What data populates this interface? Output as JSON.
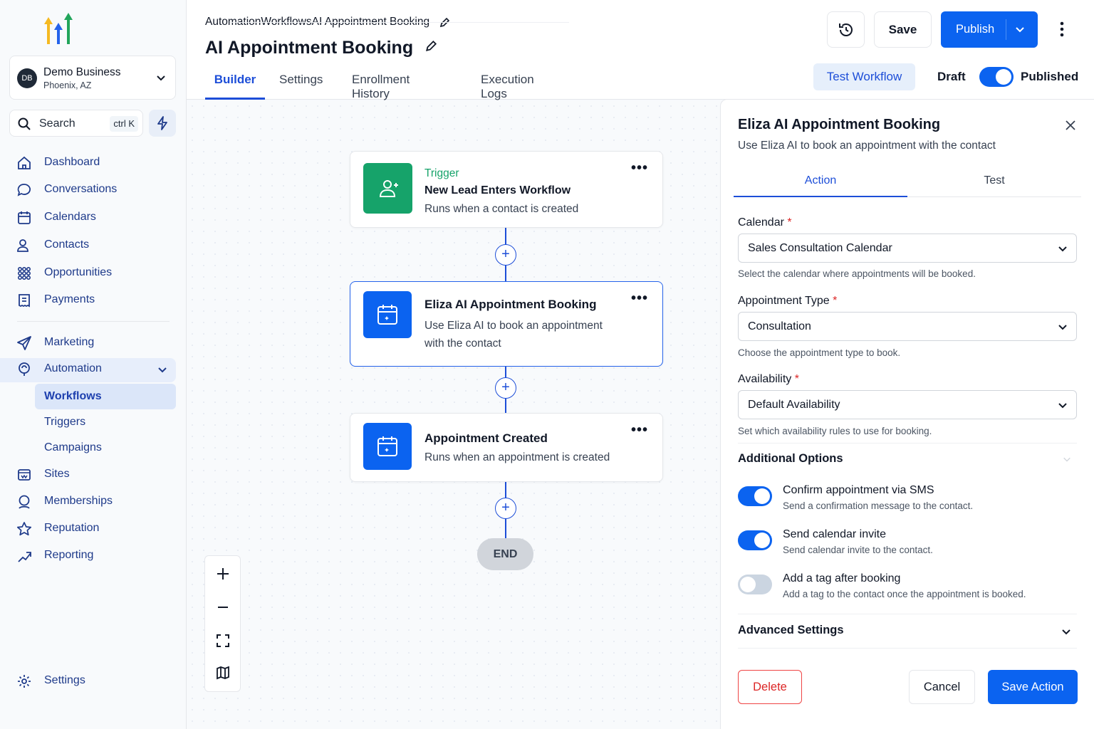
{
  "business": {
    "initials": "DB",
    "name": "Demo Business",
    "location": "Phoenix, AZ"
  },
  "search": {
    "placeholder": "Search",
    "shortcut": "ctrl K"
  },
  "nav": {
    "items": [
      {
        "label": "Dashboard",
        "icon": "home-icon"
      },
      {
        "label": "Conversations",
        "icon": "chat-icon"
      },
      {
        "label": "Calendars",
        "icon": "calendar-icon"
      },
      {
        "label": "Contacts",
        "icon": "contacts-icon"
      },
      {
        "label": "Opportunities",
        "icon": "grid-icon"
      },
      {
        "label": "Payments",
        "icon": "receipt-icon"
      },
      {
        "label": "Marketing",
        "icon": "send-icon"
      },
      {
        "label": "Automation",
        "icon": "automation-icon"
      },
      {
        "label": "Sites",
        "icon": "sites-icon"
      },
      {
        "label": "Memberships",
        "icon": "membership-icon"
      },
      {
        "label": "Reputation",
        "icon": "star-icon"
      },
      {
        "label": "Reporting",
        "icon": "chart-icon"
      }
    ],
    "automation_sub": [
      "Workflows",
      "Triggers",
      "Campaigns"
    ],
    "settings": "Settings"
  },
  "breadcrumb": [
    "Automation",
    "Workflows",
    "AI Appointment Booking"
  ],
  "page_title": "AI Appointment Booking",
  "tabs": [
    "Builder",
    "Settings",
    "Enrollment History",
    "Execution Logs"
  ],
  "header": {
    "save": "Save",
    "publish": "Publish",
    "test_workflow": "Test Workflow",
    "draft": "Draft",
    "published": "Published"
  },
  "nodes": [
    {
      "kicker": "Trigger",
      "title": "New Lead Enters Workflow",
      "desc": "Runs when a contact is created"
    },
    {
      "title": "Eliza AI Appointment Booking",
      "desc": "Use Eliza AI to book an appointment with the contact"
    },
    {
      "title": "Appointment Created",
      "desc": "Runs when an appointment is created"
    }
  ],
  "end_label": "END",
  "panel": {
    "title": "Eliza AI Appointment Booking",
    "subtitle": "Use Eliza AI to book an appointment with the contact",
    "tabs": [
      "Action",
      "Test"
    ],
    "fields": [
      {
        "label": "Calendar",
        "value": "Sales Consultation Calendar",
        "hint": "Select the calendar where appointments will be booked."
      },
      {
        "label": "Appointment Type",
        "value": "Consultation",
        "hint": "Choose the appointment type to book."
      },
      {
        "label": "Availability",
        "value": "Default Availability",
        "hint": "Set which availability rules to use for booking."
      }
    ],
    "additional_options": "Additional Options",
    "options": [
      {
        "title": "Confirm appointment via SMS",
        "desc": "Send a confirmation message to the contact.",
        "enabled": true
      },
      {
        "title": "Send calendar invite",
        "desc": "Send calendar invite to the contact.",
        "enabled": true
      },
      {
        "title": "Add a tag after booking",
        "desc": "Add a tag to the contact once the appointment is booked.",
        "enabled": false
      }
    ],
    "advanced_settings": "Advanced Settings",
    "delete": "Delete",
    "cancel": "Cancel",
    "save_action": "Save Action"
  },
  "colors": {
    "primary": "#0b63f0",
    "trigger_green": "#16a36a",
    "nav_text": "#1e3a8a"
  }
}
